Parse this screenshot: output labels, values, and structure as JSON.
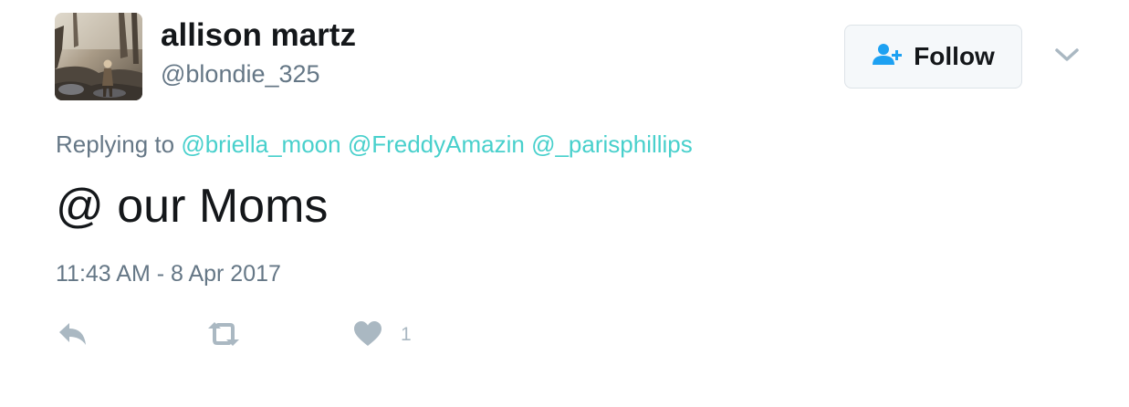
{
  "tweet": {
    "author": {
      "display_name": "allison martz",
      "username": "@blondie_325",
      "avatar_icon": "profile-photo"
    },
    "follow_button": {
      "label": "Follow",
      "icon": "add-user-icon"
    },
    "menu_icon": "chevron-down-icon",
    "replying_to": {
      "prefix": "Replying to",
      "mentions": [
        "@briella_moon",
        "@FreddyAmazin",
        "@_parisphillips"
      ]
    },
    "text": "@ our Moms",
    "timestamp": "11:43 AM - 8 Apr 2017",
    "actions": {
      "reply_icon": "reply-icon",
      "retweet_icon": "retweet-icon",
      "like_icon": "heart-icon",
      "like_count": "1"
    }
  },
  "colors": {
    "mention": "#48d0cc",
    "secondary_text": "#657786",
    "icon_gray": "#aab8c2",
    "follow_icon": "#1da1f2"
  }
}
